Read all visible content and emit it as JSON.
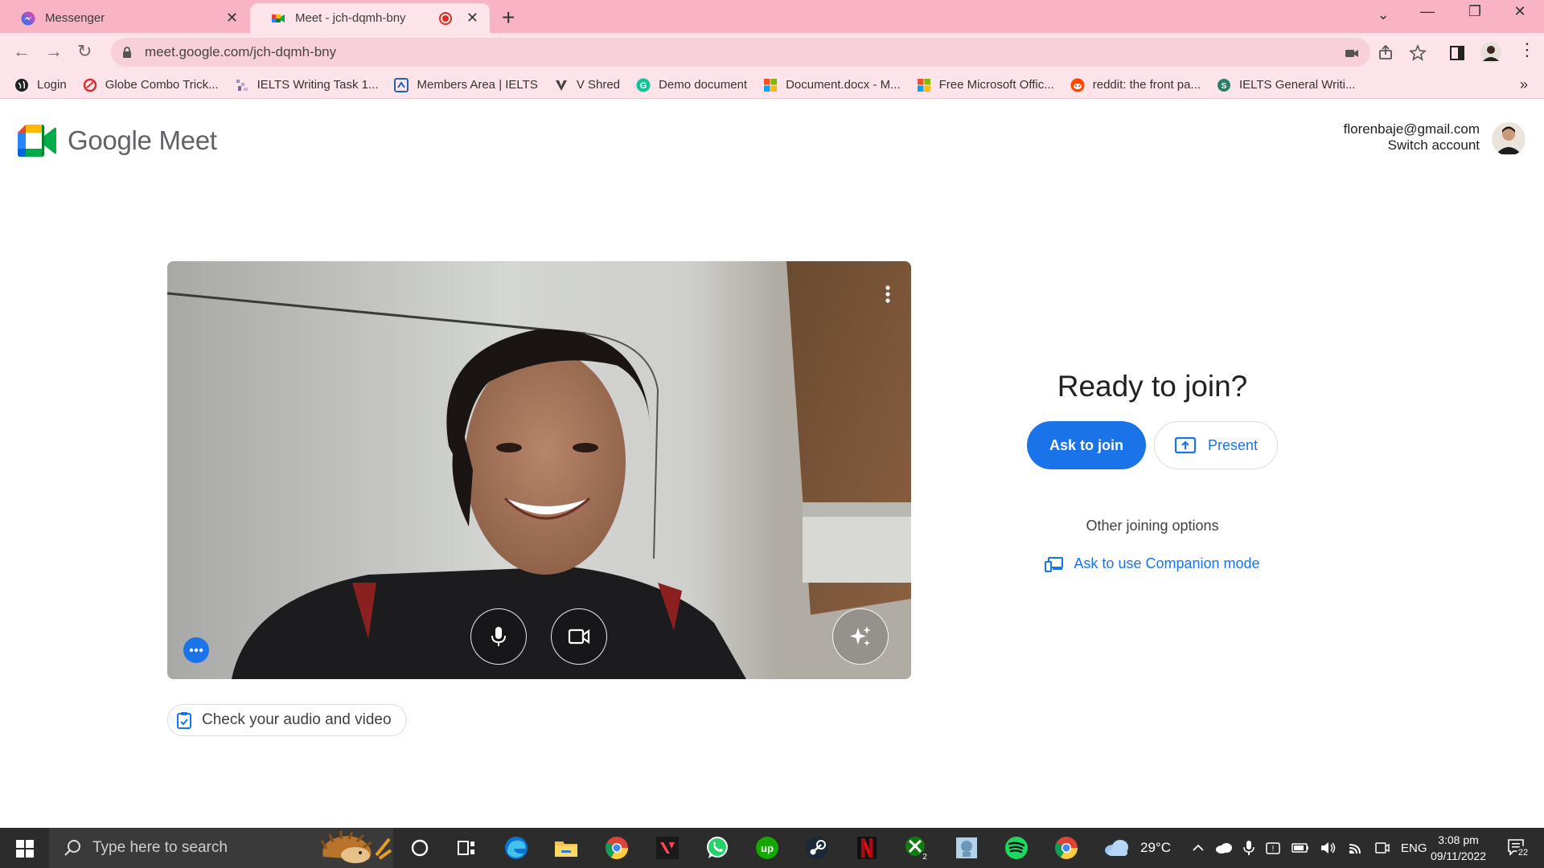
{
  "browser": {
    "tabs": [
      {
        "title": "Messenger",
        "active": false
      },
      {
        "title": "Meet - jch-dqmh-bny",
        "active": true
      }
    ],
    "url": "meet.google.com/jch-dqmh-bny",
    "bookmarks": [
      {
        "label": "Login",
        "icon": "globe-dark-icon",
        "color": "#202124"
      },
      {
        "label": "Globe Combo Trick...",
        "icon": "globe-red-icon",
        "color": "#d32f2f"
      },
      {
        "label": "IELTS Writing Task 1...",
        "icon": "ielts-icon",
        "color": "#9c8fb8"
      },
      {
        "label": "Members Area | IELTS",
        "icon": "members-icon",
        "color": "#1e63b0"
      },
      {
        "label": "V Shred",
        "icon": "vshred-icon",
        "color": "#555555"
      },
      {
        "label": "Demo document",
        "icon": "grammarly-icon",
        "color": "#15c39a"
      },
      {
        "label": "Document.docx - M...",
        "icon": "microsoft-icon",
        "color": "#f25022"
      },
      {
        "label": "Free Microsoft Offic...",
        "icon": "microsoft-icon",
        "color": "#f25022"
      },
      {
        "label": "reddit: the front pa...",
        "icon": "reddit-icon",
        "color": "#ff4500"
      },
      {
        "label": "IELTS General Writi...",
        "icon": "ielts-general-icon",
        "color": "#2e7d6b"
      }
    ]
  },
  "page": {
    "product_name": "Google Meet",
    "account_email": "florenbaje@gmail.com",
    "switch_account": "Switch account",
    "check_audio_video": "Check your audio and video",
    "ready_title": "Ready to join?",
    "ask_to_join": "Ask to join",
    "present": "Present",
    "other_options": "Other joining options",
    "companion_mode": "Ask to use Companion mode"
  },
  "taskbar": {
    "search_placeholder": "Type here to search",
    "weather": "29°C",
    "language": "ENG",
    "time": "3:08 pm",
    "date": "09/11/2022",
    "notifications": "22",
    "xbox_badge": "2"
  },
  "colors": {
    "tab_bar": "#f8b4c4",
    "toolbar": "#fde4ea",
    "accent": "#1a73e8"
  }
}
